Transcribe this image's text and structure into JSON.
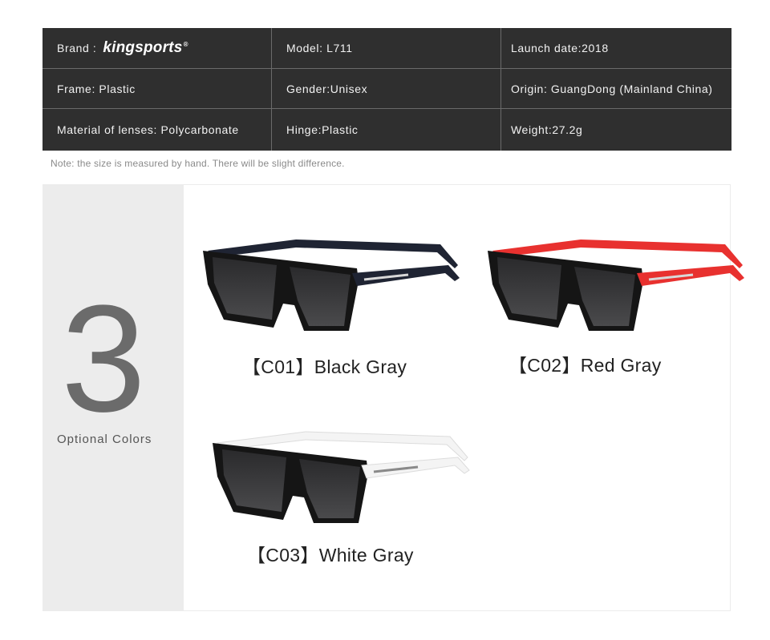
{
  "specs": {
    "brand_label": "Brand :",
    "brand_name": "kingsports",
    "brand_reg": "®",
    "model": "Model: L711",
    "launch": "Launch date:2018",
    "frame": "Frame: Plastic",
    "gender": "Gender:Unisex",
    "origin": "Origin: GuangDong (Mainland China)",
    "material": "Material of lenses: Polycarbonate",
    "hinge": "Hinge:Plastic",
    "weight": "Weight:27.2g"
  },
  "note": "Note: the size is measured by hand. There will be slight difference.",
  "colors_panel": {
    "count": "3",
    "caption": "Optional Colors",
    "options": [
      {
        "label": "【C01】Black Gray",
        "temple_color": "#1f2433"
      },
      {
        "label": "【C02】Red Gray",
        "temple_color": "#e8312f"
      },
      {
        "label": "【C03】White Gray",
        "temple_color": "#f4f4f4"
      }
    ]
  },
  "colors": {
    "table_bg": "#2f2f2f",
    "table_text": "#f2f2f2",
    "side_bg": "#ececec",
    "number": "#6b6b6b"
  }
}
